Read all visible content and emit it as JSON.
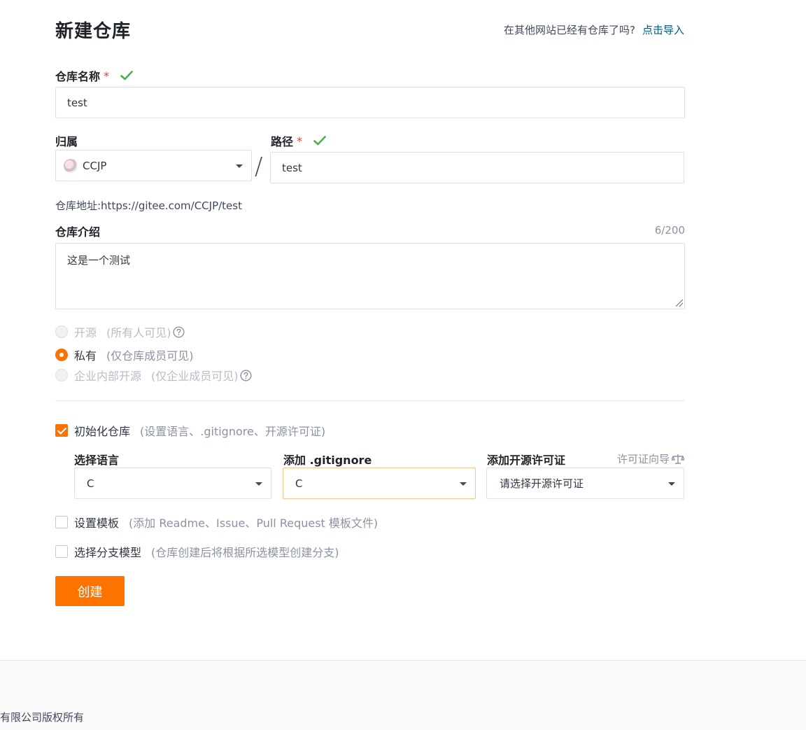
{
  "header": {
    "title": "新建仓库",
    "import_prompt": "在其他网站已经有仓库了吗?",
    "import_link": "点击导入"
  },
  "repo_name": {
    "label": "仓库名称",
    "required_mark": "*",
    "value": "test"
  },
  "owner": {
    "label": "归属",
    "value": "CCJP"
  },
  "path": {
    "label": "路径",
    "required_mark": "*",
    "separator": "/",
    "value": "test"
  },
  "address": {
    "text": "仓库地址:https://gitee.com/CCJP/test"
  },
  "description": {
    "label": "仓库介绍",
    "counter": "6/200",
    "value": "这是一个测试"
  },
  "visibility": {
    "options": [
      {
        "label": "开源",
        "hint": "(所有人可见)",
        "selected": false,
        "disabled": true
      },
      {
        "label": "私有",
        "hint": "(仅仓库成员可见)",
        "selected": true,
        "disabled": false
      },
      {
        "label": "企业内部开源",
        "hint": "(仅企业成员可见)",
        "selected": false,
        "disabled": true
      }
    ]
  },
  "init_repo": {
    "label": "初始化仓库",
    "hint": "(设置语言、.gitignore、开源许可证)",
    "checked": true
  },
  "language": {
    "label": "选择语言",
    "value": "C"
  },
  "gitignore": {
    "label": "添加 .gitignore",
    "value": "C"
  },
  "license": {
    "label": "添加开源许可证",
    "guide": "许可证向导",
    "placeholder": "请选择开源许可证"
  },
  "template": {
    "label": "设置模板",
    "hint": "(添加 Readme、Issue、Pull Request 模板文件)",
    "checked": false
  },
  "branch_model": {
    "label": "选择分支模型",
    "hint": "(仓库创建后将根据所选模型创建分支)",
    "checked": false
  },
  "submit": {
    "label": "创建"
  },
  "footer": {
    "text": "有限公司版权所有"
  },
  "colors": {
    "accent": "#fe7300",
    "link": "#005980",
    "success": "#4caf50",
    "required": "#e03b3b"
  },
  "icons": {
    "valid": "check-icon",
    "help": "question-circle-icon",
    "dropdown": "caret-down-icon",
    "guide": "scale-icon"
  }
}
